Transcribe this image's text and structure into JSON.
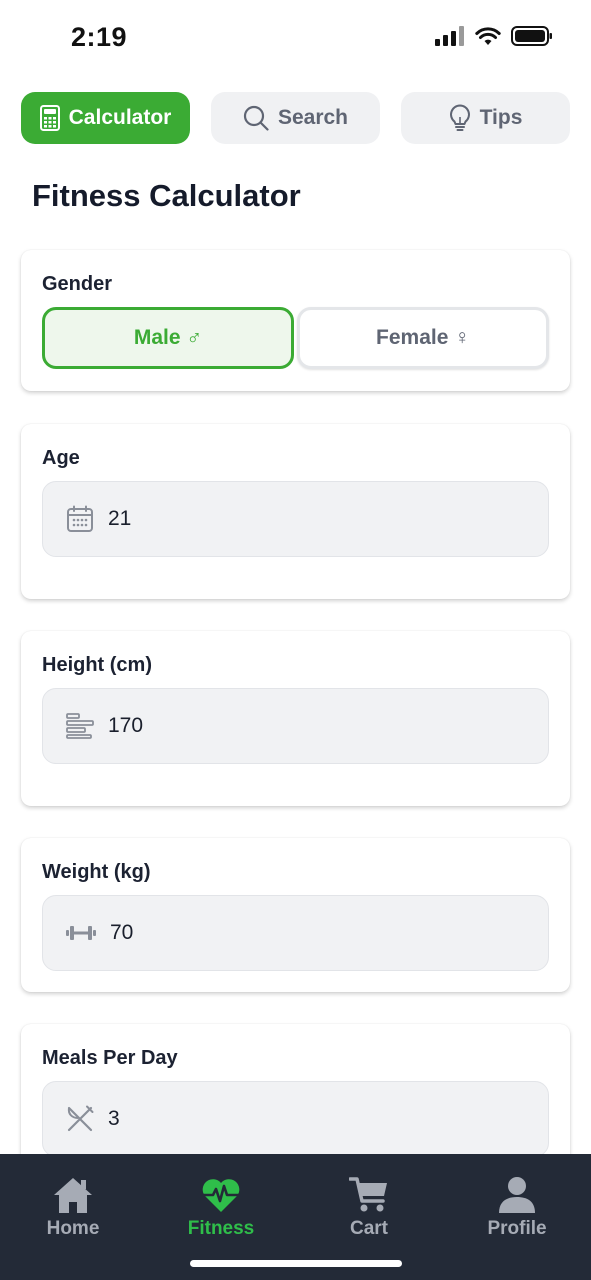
{
  "status_bar": {
    "time": "2:19",
    "icons": [
      "cellular-signal-icon",
      "wifi-icon",
      "battery-icon"
    ]
  },
  "tabs": [
    {
      "label": "Calculator",
      "icon": "calculator-icon",
      "active": true
    },
    {
      "label": "Search",
      "icon": "search-icon",
      "active": false
    },
    {
      "label": "Tips",
      "icon": "lightbulb-icon",
      "active": false
    }
  ],
  "page_title": "Fitness Calculator",
  "gender": {
    "label": "Gender",
    "options": [
      {
        "label": "Male ♂",
        "selected": true
      },
      {
        "label": "Female ♀",
        "selected": false
      }
    ]
  },
  "fields": {
    "age": {
      "label": "Age",
      "value": "21",
      "icon": "calendar-icon"
    },
    "height": {
      "label": "Height (cm)",
      "value": "170",
      "icon": "ruler-icon"
    },
    "weight": {
      "label": "Weight (kg)",
      "value": "70",
      "icon": "dumbbell-icon"
    },
    "meals": {
      "label": "Meals Per Day",
      "value": "3",
      "icon": "utensils-icon"
    }
  },
  "bottom_nav": [
    {
      "label": "Home",
      "icon": "home-icon",
      "active": false
    },
    {
      "label": "Fitness",
      "icon": "heart-pulse-icon",
      "active": true
    },
    {
      "label": "Cart",
      "icon": "cart-icon",
      "active": false
    },
    {
      "label": "Profile",
      "icon": "user-icon",
      "active": false
    }
  ],
  "colors": {
    "accent": "#3bab34",
    "nav_active": "#2fbe4a",
    "nav_background": "#232a37",
    "input_background": "#f1f2f4"
  }
}
